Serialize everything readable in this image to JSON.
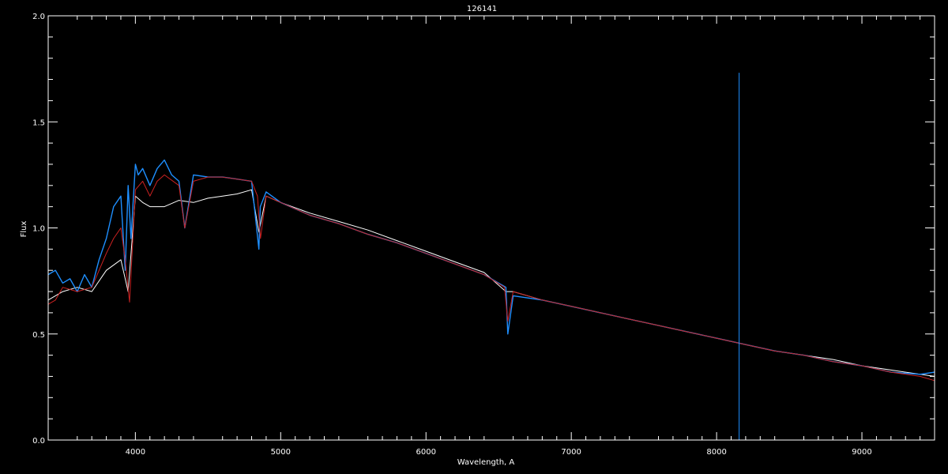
{
  "chart_data": {
    "type": "line",
    "title": "126141",
    "xlabel": "Wavelength, A",
    "ylabel": "Flux",
    "xlim": [
      3400,
      9500
    ],
    "ylim": [
      0.0,
      2.0
    ],
    "x_ticks": [
      4000,
      5000,
      6000,
      7000,
      8000,
      9000
    ],
    "x_tick_labels": [
      "4000",
      "5000",
      "6000",
      "7000",
      "8000",
      "9000"
    ],
    "y_ticks": [
      0.0,
      0.5,
      1.0,
      1.5,
      2.0
    ],
    "y_tick_labels": [
      "0.0",
      "0.5",
      "1.0",
      "1.5",
      "2.0"
    ],
    "grid": false,
    "background": "#000000",
    "axis_color": "#ffffff",
    "series": [
      {
        "color": "#ffffff",
        "x": [
          3400,
          3500,
          3600,
          3700,
          3800,
          3900,
          3950,
          4000,
          4050,
          4100,
          4200,
          4300,
          4400,
          4500,
          4600,
          4700,
          4800,
          4850,
          4900,
          5000,
          5200,
          5400,
          5600,
          5800,
          6000,
          6200,
          6400,
          6550,
          6600,
          6800,
          7000,
          7200,
          7400,
          7600,
          7800,
          8000,
          8200,
          8400,
          8600,
          8800,
          9000,
          9200,
          9400,
          9500
        ],
        "y": [
          0.66,
          0.7,
          0.72,
          0.7,
          0.8,
          0.85,
          0.7,
          1.15,
          1.12,
          1.1,
          1.1,
          1.13,
          1.12,
          1.14,
          1.15,
          1.16,
          1.18,
          0.98,
          1.15,
          1.12,
          1.07,
          1.03,
          0.99,
          0.94,
          0.89,
          0.84,
          0.79,
          0.7,
          0.7,
          0.66,
          0.63,
          0.6,
          0.57,
          0.54,
          0.51,
          0.48,
          0.45,
          0.42,
          0.4,
          0.38,
          0.35,
          0.33,
          0.31,
          0.3
        ]
      },
      {
        "color": "#1e8fff",
        "x": [
          3400,
          3450,
          3500,
          3550,
          3600,
          3650,
          3700,
          3750,
          3800,
          3850,
          3900,
          3930,
          3950,
          3970,
          4000,
          4020,
          4050,
          4100,
          4150,
          4200,
          4250,
          4300,
          4340,
          4400,
          4500,
          4600,
          4700,
          4800,
          4850,
          4860,
          4900,
          5000,
          5200,
          5400,
          5600,
          5800,
          6000,
          6200,
          6400,
          6550,
          6563,
          6600,
          6800,
          7000,
          7200,
          7400,
          7600,
          7800,
          8000,
          8200,
          8400,
          8600,
          8800,
          9000,
          9200,
          9400,
          9500
        ],
        "y": [
          0.78,
          0.8,
          0.74,
          0.76,
          0.7,
          0.78,
          0.72,
          0.85,
          0.95,
          1.1,
          1.15,
          0.8,
          1.2,
          0.95,
          1.3,
          1.25,
          1.28,
          1.2,
          1.28,
          1.32,
          1.25,
          1.22,
          1.0,
          1.25,
          1.24,
          1.24,
          1.23,
          1.22,
          0.9,
          1.1,
          1.17,
          1.12,
          1.06,
          1.02,
          0.97,
          0.93,
          0.88,
          0.83,
          0.78,
          0.72,
          0.5,
          0.68,
          0.66,
          0.63,
          0.6,
          0.57,
          0.54,
          0.51,
          0.48,
          0.45,
          0.42,
          0.4,
          0.37,
          0.35,
          0.32,
          0.31,
          0.32
        ]
      },
      {
        "color": "#cc2222",
        "x": [
          3400,
          3450,
          3500,
          3600,
          3700,
          3800,
          3850,
          3900,
          3930,
          3960,
          4000,
          4050,
          4100,
          4150,
          4200,
          4300,
          4340,
          4400,
          4500,
          4600,
          4700,
          4800,
          4840,
          4861,
          4900,
          5000,
          5200,
          5400,
          5600,
          5800,
          6000,
          6200,
          6400,
          6540,
          6563,
          6600,
          6800,
          7000,
          7200,
          7400,
          7600,
          7800,
          8000,
          8200,
          8400,
          8600,
          8800,
          9000,
          9200,
          9400,
          9500
        ],
        "y": [
          0.64,
          0.66,
          0.72,
          0.7,
          0.72,
          0.88,
          0.95,
          1.0,
          0.85,
          0.65,
          1.18,
          1.22,
          1.15,
          1.22,
          1.25,
          1.2,
          1.0,
          1.22,
          1.24,
          1.24,
          1.23,
          1.22,
          1.15,
          0.95,
          1.15,
          1.12,
          1.06,
          1.02,
          0.97,
          0.93,
          0.88,
          0.83,
          0.78,
          0.72,
          0.56,
          0.7,
          0.66,
          0.63,
          0.6,
          0.57,
          0.54,
          0.51,
          0.48,
          0.45,
          0.42,
          0.4,
          0.37,
          0.35,
          0.32,
          0.3,
          0.28
        ]
      },
      {
        "color": "#1e8fff",
        "x": [
          8155,
          8155,
          8155
        ],
        "y": [
          0.0,
          1.73,
          0.43
        ]
      }
    ]
  }
}
